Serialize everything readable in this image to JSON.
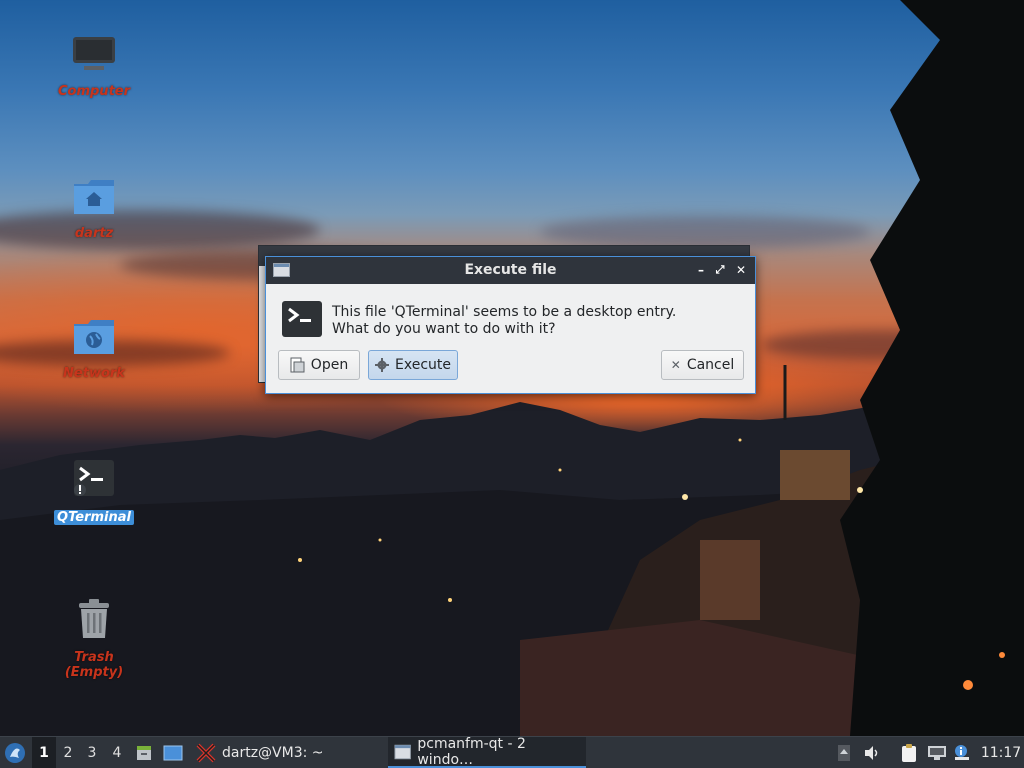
{
  "desktop": {
    "icons": [
      {
        "label": "Computer",
        "icon": "computer-icon"
      },
      {
        "label": "dartz",
        "icon": "home-folder-icon"
      },
      {
        "label": "Network",
        "icon": "network-folder-icon"
      },
      {
        "label": "QTerminal",
        "icon": "terminal-icon",
        "selected": true
      },
      {
        "label": "Trash (Empty)",
        "icon": "trash-icon"
      }
    ]
  },
  "dialog": {
    "title": "Execute file",
    "message_line1": "This file 'QTerminal' seems to be a desktop entry.",
    "message_line2": "What do you want to do with it?",
    "buttons": {
      "open": "Open",
      "execute": "Execute",
      "cancel": "Cancel"
    },
    "title_controls": {
      "minimize": "–",
      "maximize": "⤢",
      "close": "✕"
    }
  },
  "taskbar": {
    "workspaces": [
      "1",
      "2",
      "3",
      "4"
    ],
    "active_workspace": "1",
    "tasks": [
      {
        "label": "dartz@VM3: ~",
        "icon": "terminal-x-icon"
      },
      {
        "label": "pcmanfm-qt - 2 windo…",
        "icon": "window-icon",
        "active": true
      }
    ],
    "clock": "11:17"
  },
  "colors": {
    "accent": "#4a90d9",
    "desktop_label": "#c8341c",
    "titlebar": "#2f343c",
    "taskbar": "#2f343b"
  }
}
